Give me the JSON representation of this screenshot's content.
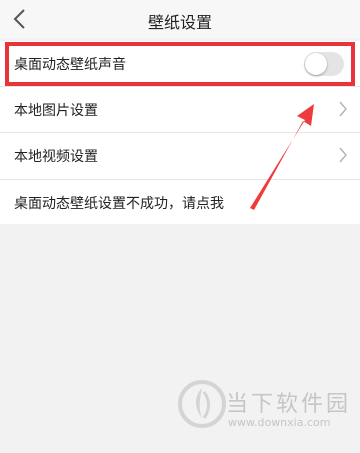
{
  "header": {
    "title": "壁纸设置",
    "back_icon": "chevron-left-icon"
  },
  "settings": {
    "items": [
      {
        "label": "桌面动态壁纸声音",
        "control": "toggle",
        "toggle_on": false
      },
      {
        "label": "本地图片设置",
        "control": "chevron-right-icon"
      },
      {
        "label": "本地视频设置",
        "control": "chevron-right-icon"
      },
      {
        "label": "桌面动态壁纸设置不成功，请点我"
      }
    ]
  },
  "annotation": {
    "highlight_color": "#e8333b",
    "arrow_color": "#ee3b3b"
  },
  "watermark": {
    "name": "当下软件园",
    "url": "www.downxia.com"
  }
}
